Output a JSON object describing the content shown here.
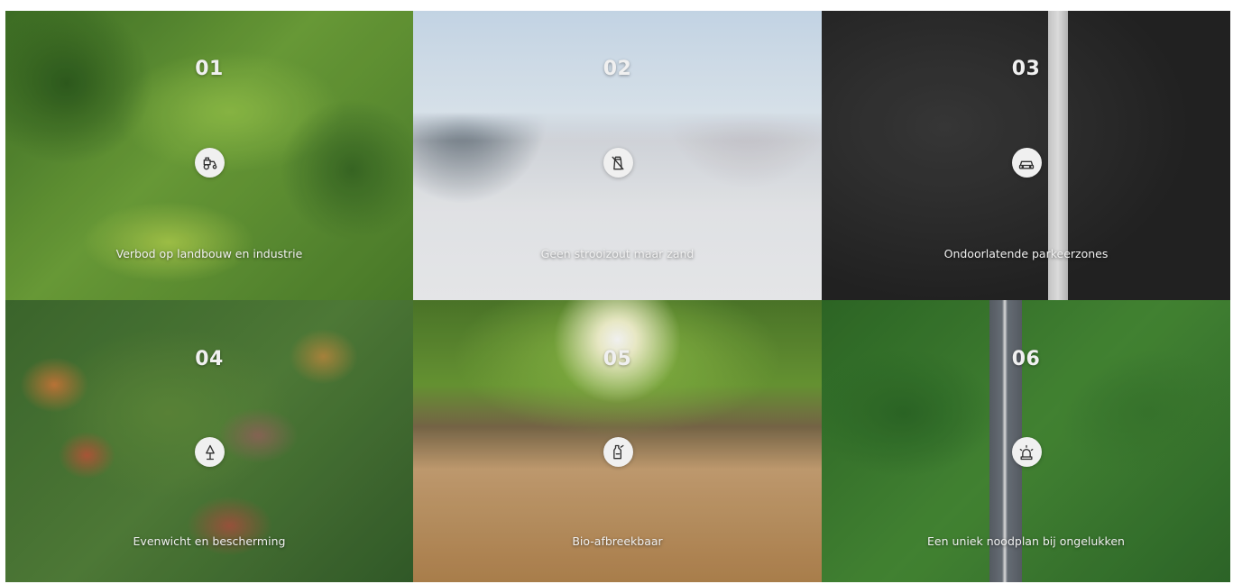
{
  "tiles": [
    {
      "number": "01",
      "caption": "Verbod op landbouw en industrie",
      "icon": "tractor-icon"
    },
    {
      "number": "02",
      "caption": "Geen strooizout maar zand",
      "icon": "salt-shaker-icon"
    },
    {
      "number": "03",
      "caption": "Ondoorlatende parkeerzones",
      "icon": "car-icon"
    },
    {
      "number": "04",
      "caption": "Evenwicht en bescherming",
      "icon": "tree-icon"
    },
    {
      "number": "05",
      "caption": "Bio-afbreekbaar",
      "icon": "bio-bottle-icon"
    },
    {
      "number": "06",
      "caption": "Een uniek noodplan bij ongelukken",
      "icon": "siren-icon"
    }
  ]
}
